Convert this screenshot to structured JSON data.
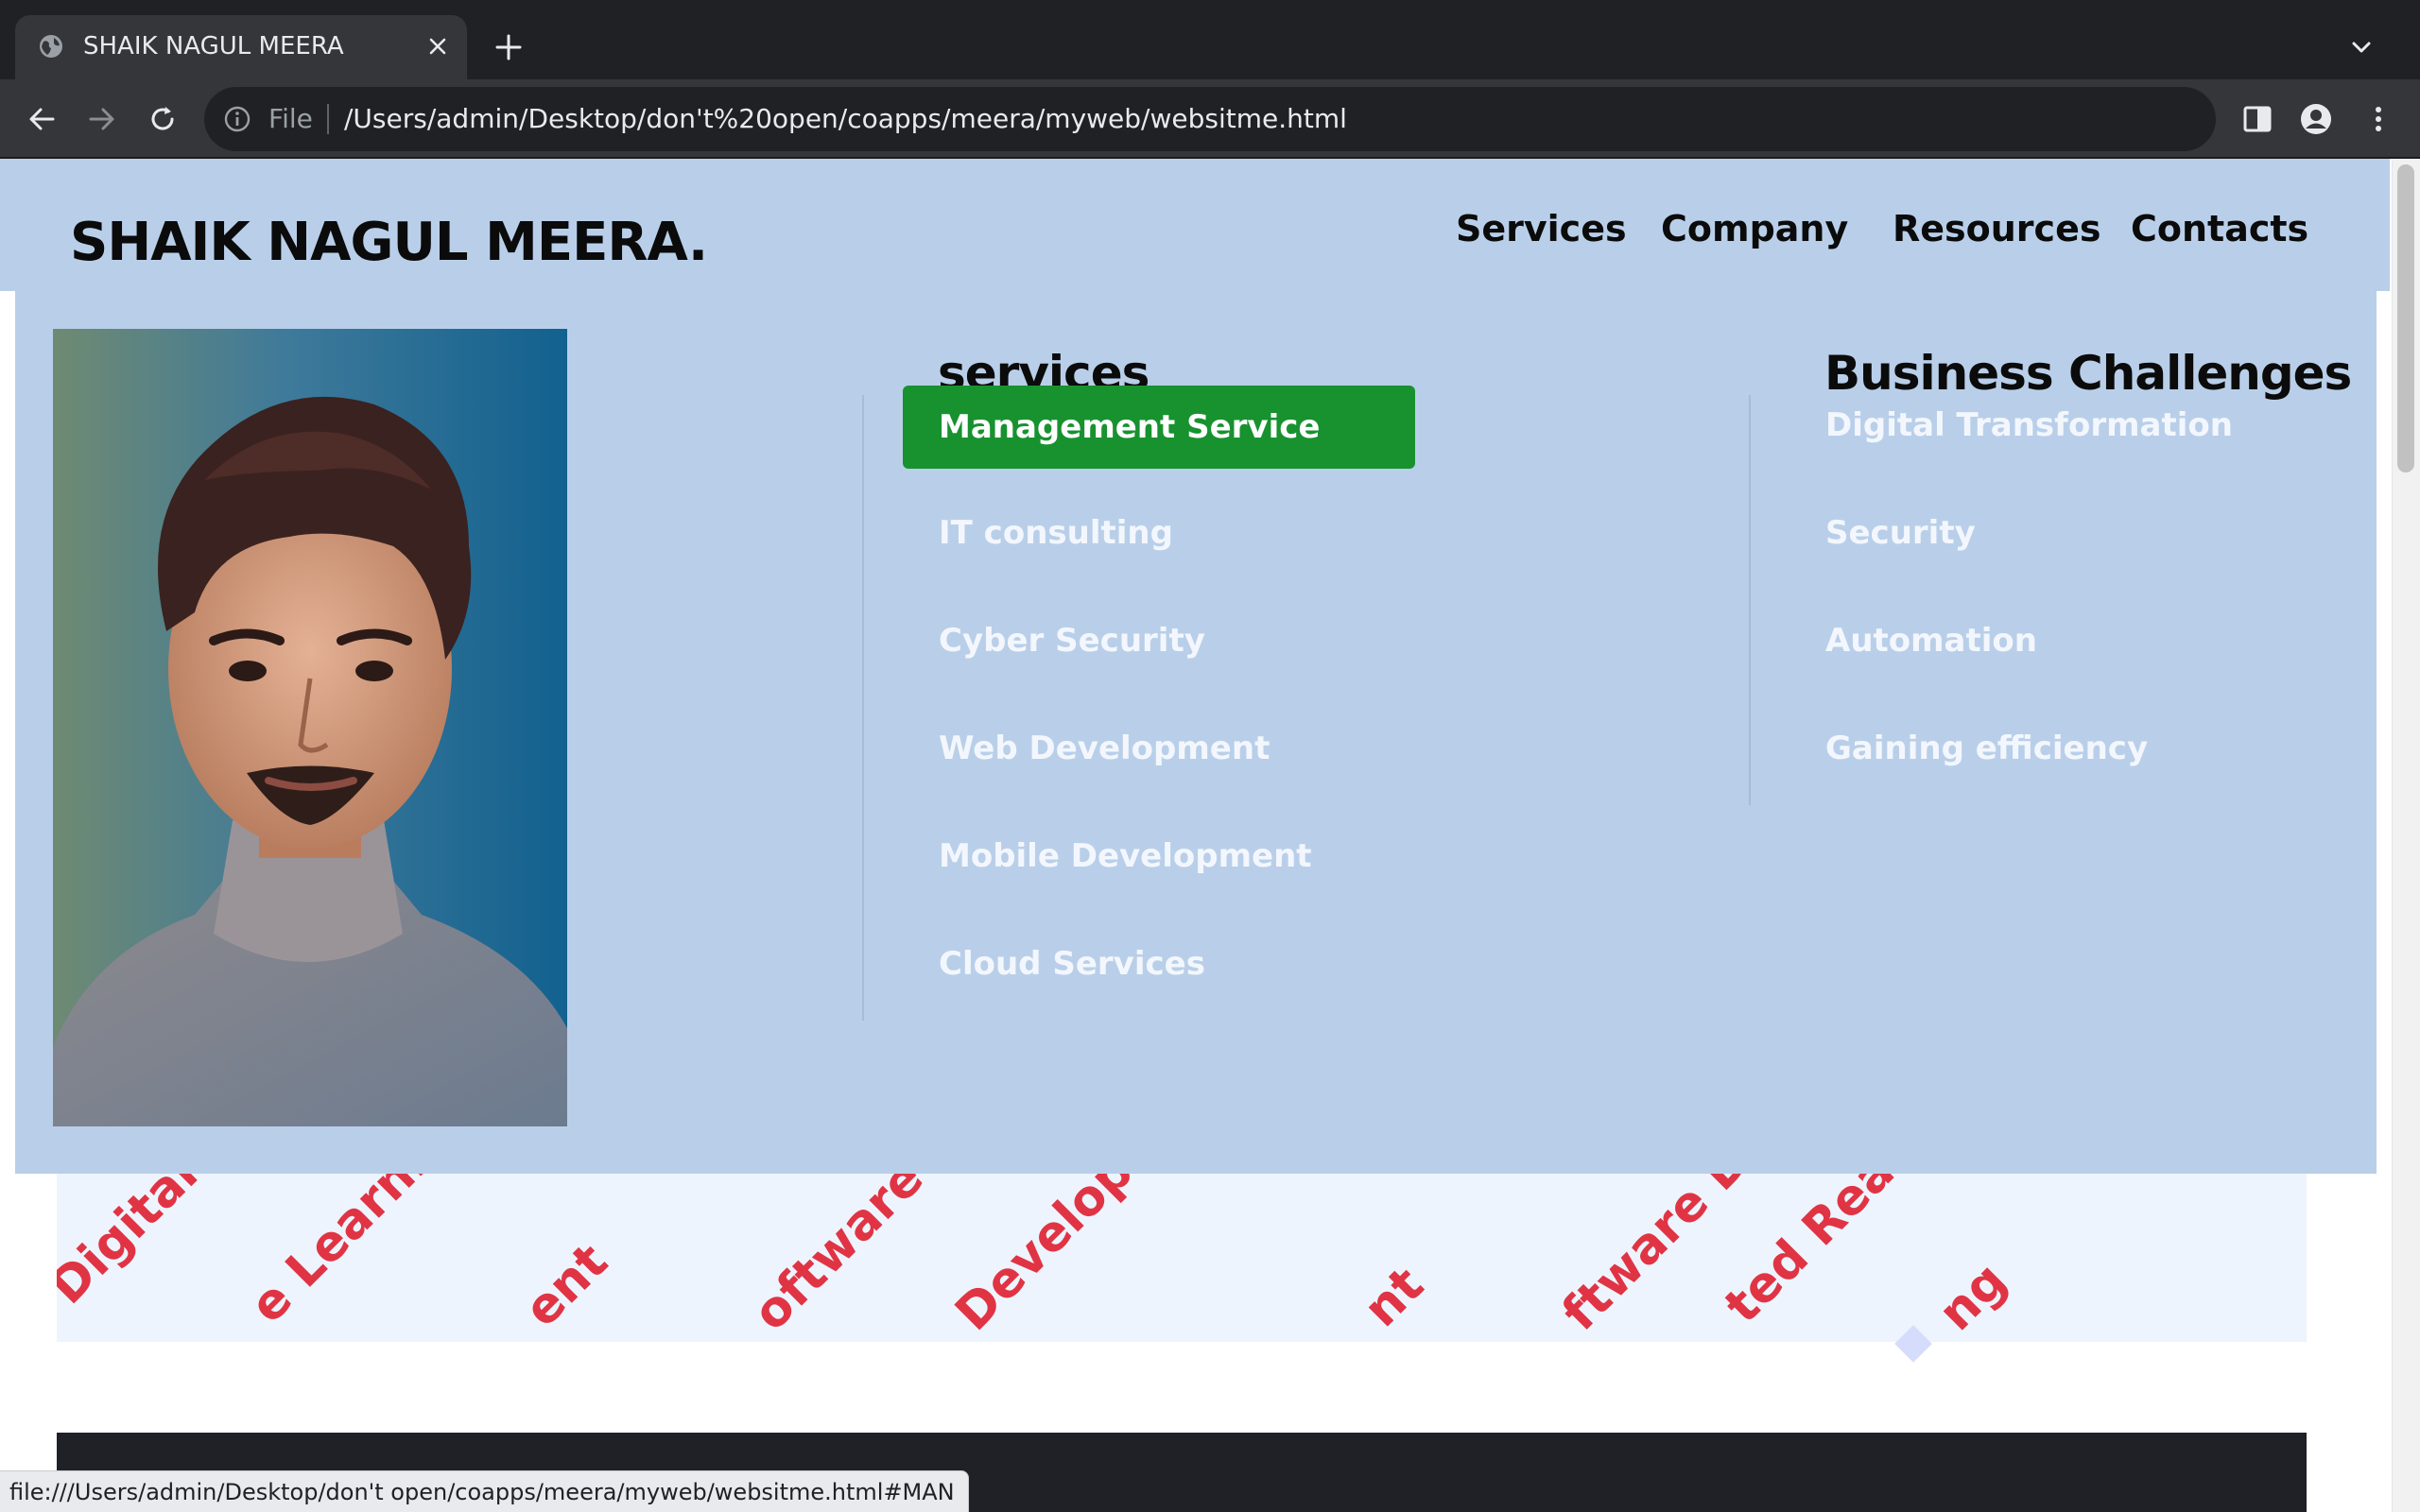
{
  "browser": {
    "tab_title": "SHAIK NAGUL MEERA",
    "address_scheme": "File",
    "address_url": "/Users/admin/Desktop/don't%20open/coapps/meera/myweb/websitme.html",
    "status_url": "file:///Users/admin/Desktop/don't open/coapps/meera/myweb/websitme.html#MAN"
  },
  "site": {
    "brand": "SHAIK NAGUL MEERA.",
    "nav": [
      "Services",
      "Company",
      "Resources",
      "Contacts"
    ]
  },
  "mega_menu": {
    "services_title": "services",
    "services": [
      "Management Service",
      "IT consulting",
      "Cyber Security",
      "Web Development",
      "Mobile Development",
      "Cloud Services"
    ],
    "challenges_title": "Business Challenges",
    "challenges": [
      "Digital Transformation",
      "Security",
      "Automation",
      "Gaining efficiency"
    ]
  },
  "marquee": {
    "words": [
      "Digital M",
      "e Learning",
      "ent",
      "oftware De",
      "Developme",
      "nt",
      "ftware Deve",
      "ted Reality",
      "ng"
    ]
  },
  "colors": {
    "header_bg": "#b9cfe9",
    "active_item_bg": "#17922f",
    "menu_text": "#f3f7fd",
    "marquee_text": "#e03444",
    "marquee_bg": "#edf4fd"
  }
}
